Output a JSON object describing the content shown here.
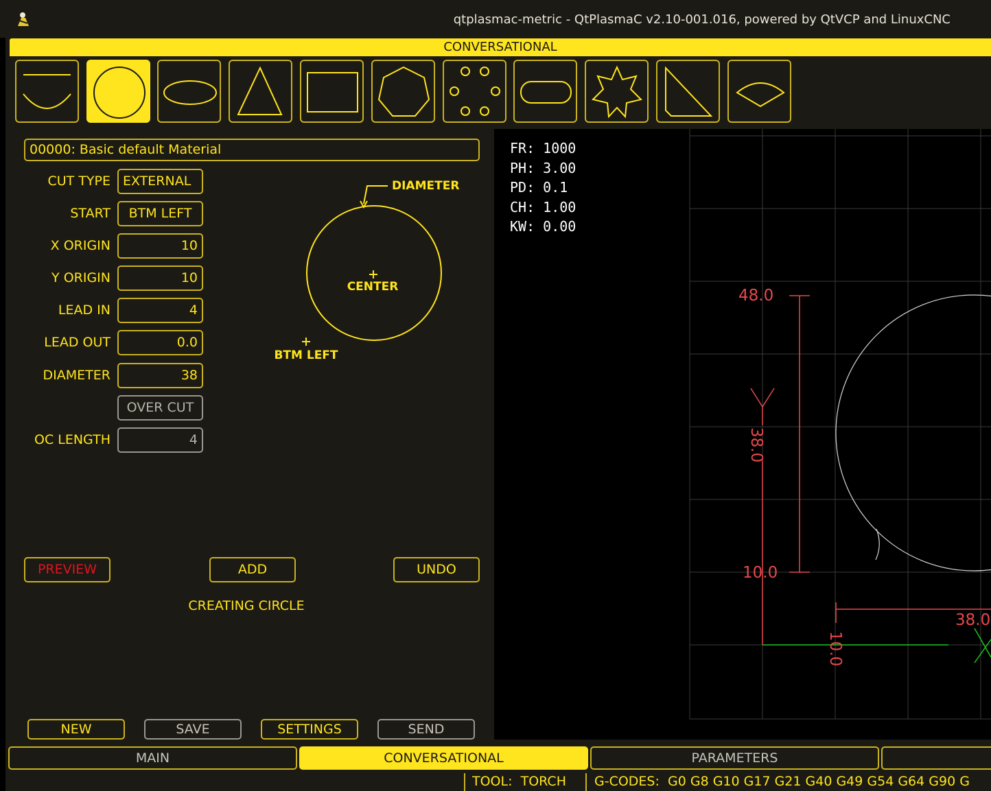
{
  "window": {
    "title": "qtplasmac-metric - QtPlasmaC v2.10-001.016, powered by QtVCP and LinuxCNC"
  },
  "header": {
    "title": "CONVERSATIONAL"
  },
  "shape_toolbar": {
    "items": [
      {
        "name": "line-arc"
      },
      {
        "name": "circle",
        "active": true
      },
      {
        "name": "ellipse"
      },
      {
        "name": "triangle"
      },
      {
        "name": "rectangle"
      },
      {
        "name": "polygon"
      },
      {
        "name": "bolt-circle"
      },
      {
        "name": "slot"
      },
      {
        "name": "star"
      },
      {
        "name": "gusset"
      },
      {
        "name": "sector"
      }
    ]
  },
  "form": {
    "material": "00000: Basic default Material",
    "cut_type": {
      "label": "CUT TYPE",
      "value": "EXTERNAL"
    },
    "start": {
      "label": "START",
      "value": "BTM LEFT"
    },
    "x_origin": {
      "label": "X ORIGIN",
      "value": "10"
    },
    "y_origin": {
      "label": "Y ORIGIN",
      "value": "10"
    },
    "lead_in": {
      "label": "LEAD IN",
      "value": "4"
    },
    "lead_out": {
      "label": "LEAD OUT",
      "value": "0.0"
    },
    "diameter": {
      "label": "DIAMETER",
      "value": "38"
    },
    "over_cut": {
      "label": "OVER CUT"
    },
    "oc_length": {
      "label": "OC LENGTH",
      "value": "4"
    }
  },
  "diagram": {
    "diameter_label": "DIAMETER",
    "center_label": "CENTER",
    "btm_left_label": "BTM LEFT"
  },
  "actions": {
    "preview": "PREVIEW",
    "add": "ADD",
    "undo": "UNDO",
    "status": "CREATING CIRCLE"
  },
  "bottom_buttons": {
    "new": "NEW",
    "save": "SAVE",
    "settings": "SETTINGS",
    "send": "SEND"
  },
  "preview": {
    "info": [
      {
        "key": "FR:",
        "value": "1000"
      },
      {
        "key": "PH:",
        "value": "3.00"
      },
      {
        "key": "PD:",
        "value": "0.1"
      },
      {
        "key": "CH:",
        "value": "1.00"
      },
      {
        "key": "KW:",
        "value": "0.00"
      }
    ],
    "dims": {
      "y_top": "48.0",
      "y_bottom": "10.0",
      "y_extent": "38.0",
      "x_left": "10.0",
      "x_extent": "38.0"
    },
    "axis_y": "Y",
    "axis_x": "X"
  },
  "tabs": [
    {
      "label": "MAIN"
    },
    {
      "label": "CONVERSATIONAL",
      "active": true
    },
    {
      "label": "PARAMETERS"
    },
    {
      "label": ""
    }
  ],
  "status_bar": {
    "tool_label": "TOOL:",
    "tool_value": "TORCH",
    "gcodes_label": "G-CODES:",
    "gcodes_value": "G0 G8 G10 G17 G21 G40 G49 G54 G64 G90 G"
  },
  "colors": {
    "accent": "#ffe51d",
    "panel": "#1c1a14",
    "border": "#c9b21e",
    "preview_bg": "#000000",
    "dim_red": "#e8484e",
    "axis_green": "#1ec81e"
  }
}
